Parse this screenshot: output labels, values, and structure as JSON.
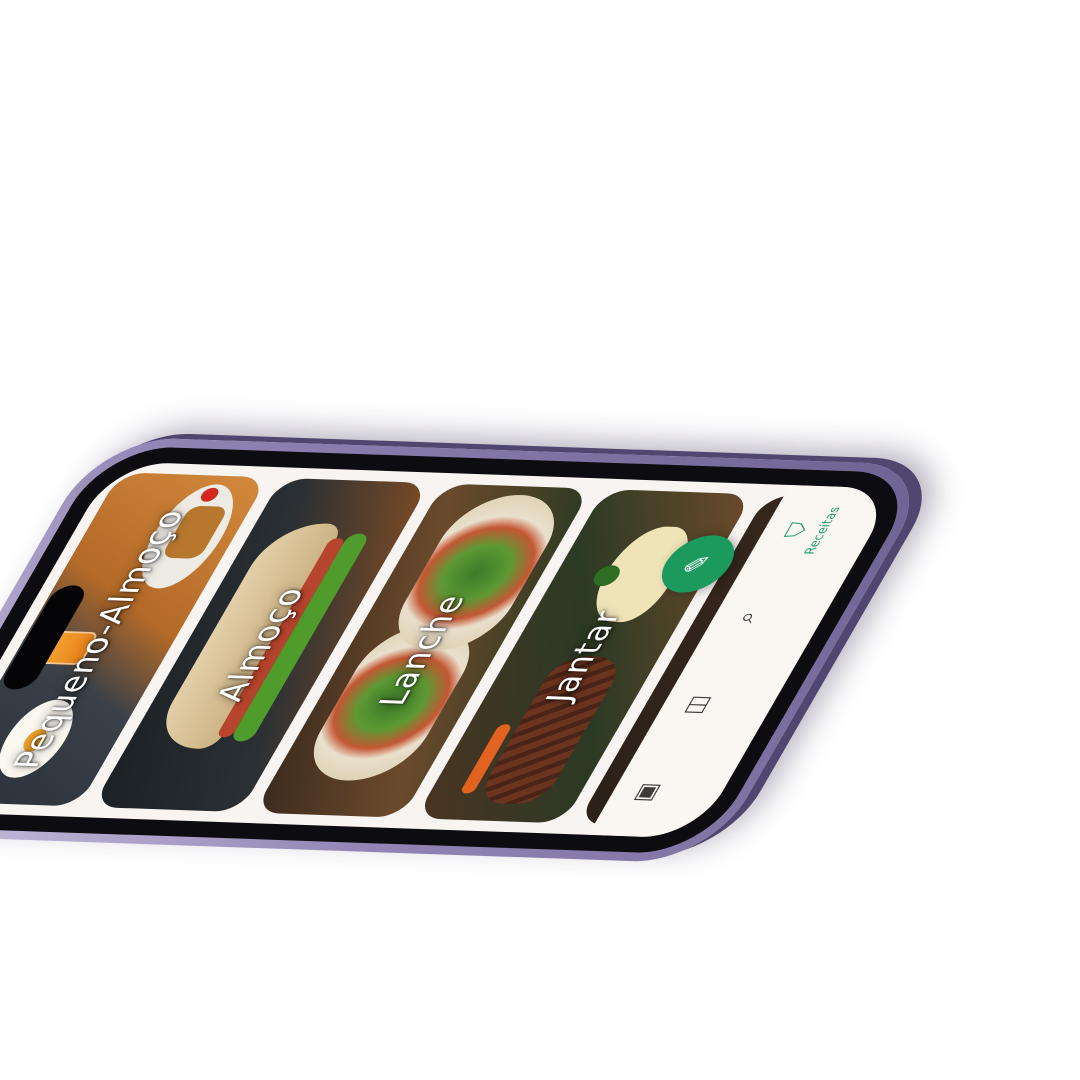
{
  "app": {
    "categories": [
      {
        "id": "pequeno-almoco",
        "label": "Pequeno-Almoço"
      },
      {
        "id": "almoco",
        "label": "Almoço"
      },
      {
        "id": "lanche",
        "label": "Lanche"
      },
      {
        "id": "jantar",
        "label": "Jantar"
      },
      {
        "id": "extra",
        "label": ""
      }
    ],
    "nav": {
      "items": [
        {
          "icon": "archive-icon",
          "glyph": "▣",
          "label": ""
        },
        {
          "icon": "map-icon",
          "glyph": "◫",
          "label": ""
        },
        {
          "icon": "search-scribble-icon",
          "glyph": "⌕",
          "label": ""
        },
        {
          "icon": "blender-icon",
          "glyph": "⛉",
          "label": "Receitas"
        }
      ],
      "active_label": "Receitas"
    },
    "fab": {
      "icon": "hairdryer-icon",
      "glyph": "✎"
    },
    "colors": {
      "accent": "#1fa06a",
      "fab": "#1c9a5e",
      "phone_frame": "#8f84b4",
      "screen_bg": "#f7f4f1"
    }
  }
}
